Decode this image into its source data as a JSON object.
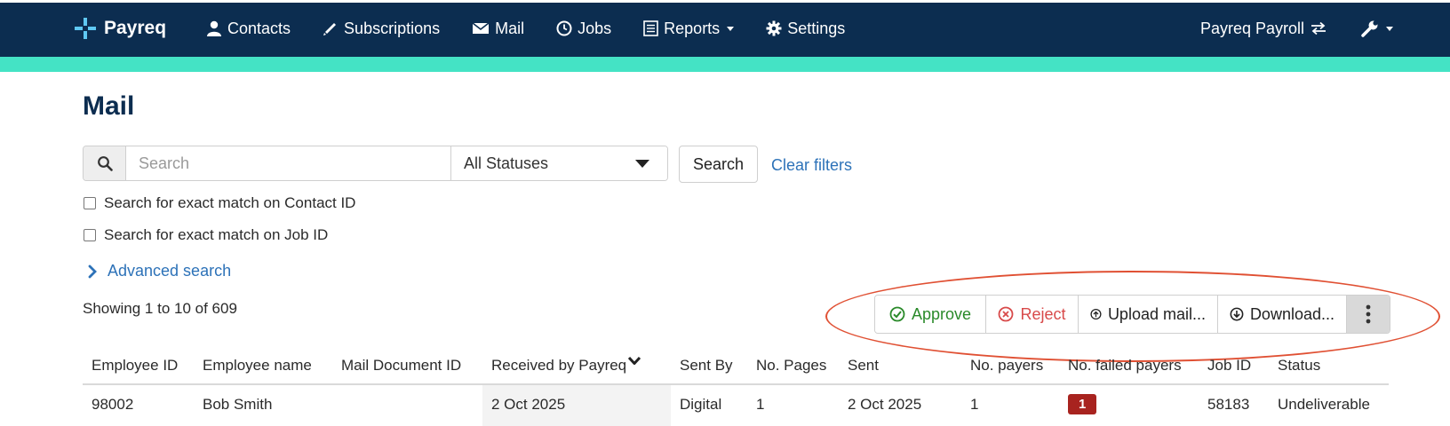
{
  "navbar": {
    "brand": "Payreq",
    "items": [
      {
        "label": "Contacts",
        "icon": "user-icon"
      },
      {
        "label": "Subscriptions",
        "icon": "pencil-icon"
      },
      {
        "label": "Mail",
        "icon": "envelope-icon"
      },
      {
        "label": "Jobs",
        "icon": "clock-icon"
      },
      {
        "label": "Reports",
        "icon": "list-icon",
        "dropdown": true
      },
      {
        "label": "Settings",
        "icon": "gear-icon"
      }
    ],
    "account": "Payreq Payroll",
    "colors": {
      "bar": "#0c2d50",
      "accent": "#44e3c5"
    }
  },
  "page": {
    "title": "Mail"
  },
  "filters": {
    "search_placeholder": "Search",
    "search_value": "",
    "status_selected": "All Statuses",
    "search_button": "Search",
    "clear_filters": "Clear filters",
    "exact_contact": "Search for exact match on Contact ID",
    "exact_job": "Search for exact match on Job ID",
    "advanced_search": "Advanced search"
  },
  "results": {
    "showing": "Showing 1 to 10 of 609"
  },
  "actions": {
    "approve": "Approve",
    "reject": "Reject",
    "upload": "Upload mail...",
    "download": "Download..."
  },
  "table": {
    "columns": [
      "Employee ID",
      "Employee name",
      "Mail Document ID",
      "Received by Payreq",
      "Sent By",
      "No. Pages",
      "Sent",
      "No. payers",
      "No. failed payers",
      "Job ID",
      "Status"
    ],
    "rows": [
      {
        "employee_id": "98002",
        "employee_name": "Bob Smith",
        "mail_document_id": "",
        "received": "2 Oct 2025",
        "sent_by": "Digital",
        "pages": "1",
        "sent": "2 Oct 2025",
        "payers": "1",
        "failed_payers": "1",
        "job_id": "58183",
        "status": "Undeliverable"
      }
    ]
  }
}
